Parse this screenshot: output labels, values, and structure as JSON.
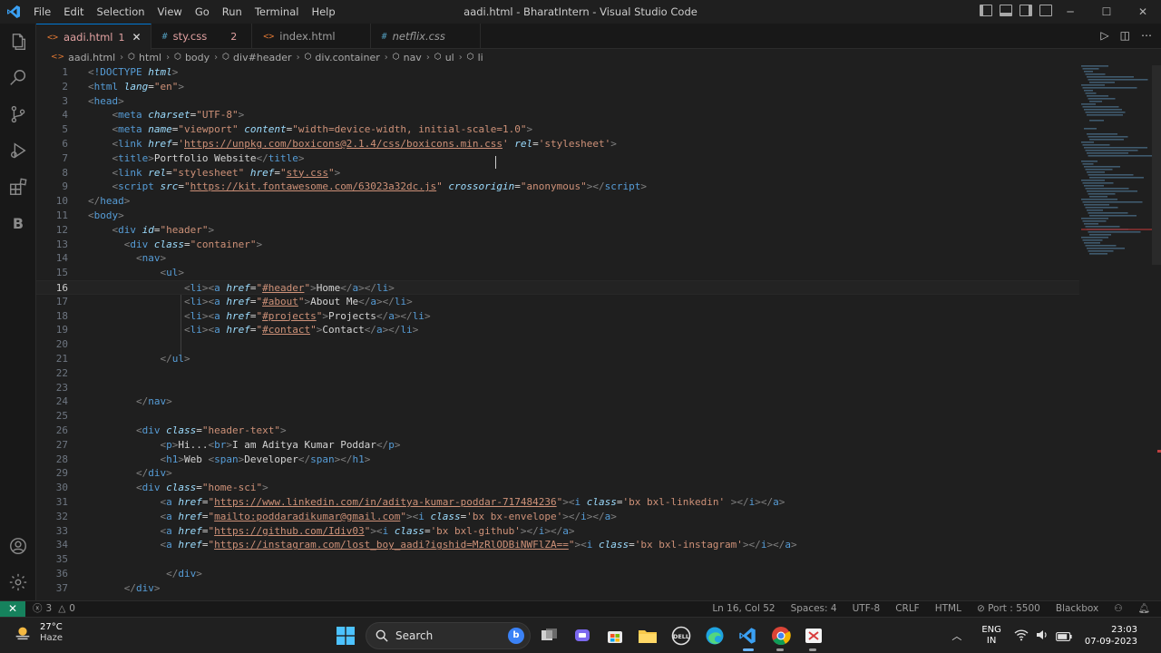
{
  "window": {
    "title": "aadi.html - BharatIntern - Visual Studio Code",
    "menu": [
      "File",
      "Edit",
      "Selection",
      "View",
      "Go",
      "Run",
      "Terminal",
      "Help"
    ]
  },
  "tabs": [
    {
      "label": "aadi.html",
      "icon": "<>",
      "badge": "1",
      "active": true,
      "color": "#e0a0a0"
    },
    {
      "label": "sty.css",
      "icon": "#",
      "badge": "2",
      "active": false,
      "color": "#e0a0a0"
    },
    {
      "label": "index.html",
      "icon": "<>",
      "badge": "",
      "active": false,
      "color": "#9d9d9d"
    },
    {
      "label": "netflix.css",
      "icon": "#",
      "badge": "",
      "active": false,
      "color": "#9d9d9d"
    }
  ],
  "breadcrumb": [
    "aadi.html",
    "html",
    "body",
    "div#header",
    "div.container",
    "nav",
    "ul",
    "li"
  ],
  "editor": {
    "current_line": 16,
    "lines": [
      {
        "n": "1",
        "html": "<span class='t-p'>&lt;</span><span class='t-tag'>!DOCTYPE</span> <span class='t-attr-i'>html</span><span class='t-p'>&gt;</span>"
      },
      {
        "n": "2",
        "html": "<span class='t-p'>&lt;</span><span class='t-tag'>html</span> <span class='t-attr-i'>lang</span><span class='t-text'>=</span><span class='t-str'>\"en\"</span><span class='t-p'>&gt;</span>"
      },
      {
        "n": "3",
        "html": "<span class='t-p'>&lt;</span><span class='t-tag'>head</span><span class='t-p'>&gt;</span>"
      },
      {
        "n": "4",
        "html": "    <span class='t-p'>&lt;</span><span class='t-tag'>meta</span> <span class='t-attr-i'>charset</span><span class='t-text'>=</span><span class='t-str'>\"UTF-8\"</span><span class='t-p'>&gt;</span>"
      },
      {
        "n": "5",
        "html": "    <span class='t-p'>&lt;</span><span class='t-tag'>meta</span> <span class='t-attr-i'>name</span><span class='t-text'>=</span><span class='t-str'>\"viewport\"</span> <span class='t-attr-i'>content</span><span class='t-text'>=</span><span class='t-str'>\"width=device-width, initial-scale=1.0\"</span><span class='t-p'>&gt;</span>"
      },
      {
        "n": "6",
        "html": "    <span class='t-p'>&lt;</span><span class='t-tag'>link</span> <span class='t-attr-i'>href</span><span class='t-text'>=</span><span class='t-str'>'</span><span class='t-link'>https://unpkg.com/boxicons@2.1.4/css/boxicons.min.css</span><span class='t-str'>'</span> <span class='t-attr-i'>rel</span><span class='t-text'>=</span><span class='t-str'>'stylesheet'</span><span class='t-p'>&gt;</span>"
      },
      {
        "n": "7",
        "html": "    <span class='t-p'>&lt;</span><span class='t-tag'>title</span><span class='t-p'>&gt;</span><span class='t-text'>Portfolio Website</span><span class='t-p'>&lt;/</span><span class='t-tag'>title</span><span class='t-p'>&gt;</span>"
      },
      {
        "n": "8",
        "html": "    <span class='t-p'>&lt;</span><span class='t-tag'>link</span> <span class='t-attr-i'>rel</span><span class='t-text'>=</span><span class='t-str'>\"stylesheet\"</span> <span class='t-attr-i'>href</span><span class='t-text'>=</span><span class='t-str'>\"</span><span class='t-link'>sty.css</span><span class='t-str'>\"</span><span class='t-p'>&gt;</span>"
      },
      {
        "n": "9",
        "html": "    <span class='t-p'>&lt;</span><span class='t-tag'>script</span> <span class='t-attr-i'>src</span><span class='t-text'>=</span><span class='t-str'>\"</span><span class='t-link'>https://kit.fontawesome.com/63023a32dc.js</span><span class='t-str'>\"</span> <span class='t-attr-i'>crossorigin</span><span class='t-text'>=</span><span class='t-str'>\"anonymous\"</span><span class='t-p'>&gt;&lt;/</span><span class='t-tag'>script</span><span class='t-p'>&gt;</span>"
      },
      {
        "n": "10",
        "html": "<span class='t-p'>&lt;/</span><span class='t-tag'>head</span><span class='t-p'>&gt;</span>"
      },
      {
        "n": "11",
        "html": "<span class='t-p'>&lt;</span><span class='t-tag'>body</span><span class='t-p'>&gt;</span>"
      },
      {
        "n": "12",
        "html": "    <span class='t-p'>&lt;</span><span class='t-tag'>div</span> <span class='t-attr-i'>id</span><span class='t-text'>=</span><span class='t-str'>\"header\"</span><span class='t-p'>&gt;</span>"
      },
      {
        "n": "13",
        "html": "      <span class='t-p'>&lt;</span><span class='t-tag'>div</span> <span class='t-attr-i'>class</span><span class='t-text'>=</span><span class='t-str'>\"container\"</span><span class='t-p'>&gt;</span>"
      },
      {
        "n": "14",
        "html": "        <span class='t-p'>&lt;</span><span class='t-tag'>nav</span><span class='t-p'>&gt;</span>"
      },
      {
        "n": "15",
        "html": "            <span class='t-p'>&lt;</span><span class='t-tag'>ul</span><span class='t-p'>&gt;</span>"
      },
      {
        "n": "16",
        "html": "                <span class='t-p'>&lt;</span><span class='t-tag'>li</span><span class='t-p'>&gt;&lt;</span><span class='t-tag'>a</span> <span class='t-attr-i'>href</span><span class='t-text'>=</span><span class='t-str'>\"</span><span class='t-link'>#header</span><span class='t-str'>\"</span><span class='t-p'>&gt;</span><span class='t-text'>Home</span><span class='t-p'>&lt;/</span><span class='t-tag'>a</span><span class='t-p'>&gt;&lt;/</span><span class='t-tag'>li</span><span class='t-p'>&gt;</span>"
      },
      {
        "n": "17",
        "html": "                <span class='t-p'>&lt;</span><span class='t-tag'>li</span><span class='t-p'>&gt;&lt;</span><span class='t-tag'>a</span> <span class='t-attr-i'>href</span><span class='t-text'>=</span><span class='t-str'>\"</span><span class='t-link'>#about</span><span class='t-str'>\"</span><span class='t-p'>&gt;</span><span class='t-text'>About Me</span><span class='t-p'>&lt;/</span><span class='t-tag'>a</span><span class='t-p'>&gt;&lt;/</span><span class='t-tag'>li</span><span class='t-p'>&gt;</span>"
      },
      {
        "n": "18",
        "html": "                <span class='t-p'>&lt;</span><span class='t-tag'>li</span><span class='t-p'>&gt;&lt;</span><span class='t-tag'>a</span> <span class='t-attr-i'>href</span><span class='t-text'>=</span><span class='t-str'>\"</span><span class='t-link'>#projects</span><span class='t-str'>\"</span><span class='t-p'>&gt;</span><span class='t-text'>Projects</span><span class='t-p'>&lt;/</span><span class='t-tag'>a</span><span class='t-p'>&gt;&lt;/</span><span class='t-tag'>li</span><span class='t-p'>&gt;</span>"
      },
      {
        "n": "19",
        "html": "                <span class='t-p'>&lt;</span><span class='t-tag'>li</span><span class='t-p'>&gt;&lt;</span><span class='t-tag'>a</span> <span class='t-attr-i'>href</span><span class='t-text'>=</span><span class='t-str'>\"</span><span class='t-link'>#contact</span><span class='t-str'>\"</span><span class='t-p'>&gt;</span><span class='t-text'>Contact</span><span class='t-p'>&lt;/</span><span class='t-tag'>a</span><span class='t-p'>&gt;&lt;/</span><span class='t-tag'>li</span><span class='t-p'>&gt;</span>"
      },
      {
        "n": "20",
        "html": ""
      },
      {
        "n": "21",
        "html": "            <span class='t-p'>&lt;/</span><span class='t-tag'>ul</span><span class='t-p'>&gt;</span>"
      },
      {
        "n": "22",
        "html": ""
      },
      {
        "n": "23",
        "html": ""
      },
      {
        "n": "24",
        "html": "        <span class='t-p'>&lt;/</span><span class='t-tag'>nav</span><span class='t-p'>&gt;</span>"
      },
      {
        "n": "25",
        "html": ""
      },
      {
        "n": "26",
        "html": "        <span class='t-p'>&lt;</span><span class='t-tag'>div</span> <span class='t-attr-i'>class</span><span class='t-text'>=</span><span class='t-str'>\"header-text\"</span><span class='t-p'>&gt;</span>"
      },
      {
        "n": "27",
        "html": "            <span class='t-p'>&lt;</span><span class='t-tag'>p</span><span class='t-p'>&gt;</span><span class='t-text'>Hi...</span><span class='t-p'>&lt;</span><span class='t-tag'>br</span><span class='t-p'>&gt;</span><span class='t-text'>I am Aditya Kumar Poddar</span><span class='t-p'>&lt;/</span><span class='t-tag'>p</span><span class='t-p'>&gt;</span>"
      },
      {
        "n": "28",
        "html": "            <span class='t-p'>&lt;</span><span class='t-tag'>h1</span><span class='t-p'>&gt;</span><span class='t-text'>Web </span><span class='t-p'>&lt;</span><span class='t-tag'>span</span><span class='t-p'>&gt;</span><span class='t-text'>Developer</span><span class='t-p'>&lt;/</span><span class='t-tag'>span</span><span class='t-p'>&gt;&lt;/</span><span class='t-tag'>h1</span><span class='t-p'>&gt;</span>"
      },
      {
        "n": "29",
        "html": "        <span class='t-p'>&lt;/</span><span class='t-tag'>div</span><span class='t-p'>&gt;</span>"
      },
      {
        "n": "30",
        "html": "        <span class='t-p'>&lt;</span><span class='t-tag'>div</span> <span class='t-attr-i'>class</span><span class='t-text'>=</span><span class='t-str'>\"home-sci\"</span><span class='t-p'>&gt;</span>"
      },
      {
        "n": "31",
        "html": "            <span class='t-p'>&lt;</span><span class='t-tag'>a</span> <span class='t-attr-i'>href</span><span class='t-text'>=</span><span class='t-str'>\"</span><span class='t-link'>https://www.linkedin.com/in/aditya-kumar-poddar-717484236</span><span class='t-str'>\"</span><span class='t-p'>&gt;&lt;</span><span class='t-tag'>i</span> <span class='t-attr-i'>class</span><span class='t-text'>=</span><span class='t-str'>'bx bxl-linkedin'</span> <span class='t-p'>&gt;&lt;/</span><span class='t-tag'>i</span><span class='t-p'>&gt;&lt;/</span><span class='t-tag'>a</span><span class='t-p'>&gt;</span>"
      },
      {
        "n": "32",
        "html": "            <span class='t-p'>&lt;</span><span class='t-tag'>a</span> <span class='t-attr-i'>href</span><span class='t-text'>=</span><span class='t-str'>\"</span><span class='t-link'>mailto:poddaradikumar@gmail.com</span><span class='t-str'>\"</span><span class='t-p'>&gt;&lt;</span><span class='t-tag'>i</span> <span class='t-attr-i'>class</span><span class='t-text'>=</span><span class='t-str'>'bx bx-envelope'</span><span class='t-p'>&gt;&lt;/</span><span class='t-tag'>i</span><span class='t-p'>&gt;&lt;/</span><span class='t-tag'>a</span><span class='t-p'>&gt;</span>"
      },
      {
        "n": "33",
        "html": "            <span class='t-p'>&lt;</span><span class='t-tag'>a</span> <span class='t-attr-i'>href</span><span class='t-text'>=</span><span class='t-str'>\"</span><span class='t-link'>https://github.com/Idiv03</span><span class='t-str'>\"</span><span class='t-p'>&gt;&lt;</span><span class='t-tag'>i</span> <span class='t-attr-i'>class</span><span class='t-text'>=</span><span class='t-str'>'bx bxl-github'</span><span class='t-p'>&gt;&lt;/</span><span class='t-tag'>i</span><span class='t-p'>&gt;&lt;/</span><span class='t-tag'>a</span><span class='t-p'>&gt;</span>"
      },
      {
        "n": "34",
        "html": "            <span class='t-p'>&lt;</span><span class='t-tag'>a</span> <span class='t-attr-i'>href</span><span class='t-text'>=</span><span class='t-str'>\"</span><span class='t-link'>https://instagram.com/lost_boy_aadi?igshid=MzRlODBiNWFlZA==</span><span class='t-str'>\"</span><span class='t-p'>&gt;&lt;</span><span class='t-tag'>i</span> <span class='t-attr-i'>class</span><span class='t-text'>=</span><span class='t-str'>'bx bxl-instagram'</span><span class='t-p'>&gt;&lt;/</span><span class='t-tag'>i</span><span class='t-p'>&gt;&lt;/</span><span class='t-tag'>a</span><span class='t-p'>&gt;</span>"
      },
      {
        "n": "35",
        "html": ""
      },
      {
        "n": "36",
        "html": "             <span class='t-p'>&lt;/</span><span class='t-tag'>div</span><span class='t-p'>&gt;</span>"
      },
      {
        "n": "37",
        "html": "      <span class='t-p'>&lt;/</span><span class='t-tag'>div</span><span class='t-p'>&gt;</span>"
      }
    ]
  },
  "status": {
    "errors": "3",
    "warnings": "0",
    "position": "Ln 16, Col 52",
    "spaces": "Spaces: 4",
    "encoding": "UTF-8",
    "eol": "CRLF",
    "language": "HTML",
    "port": "Port : 5500",
    "extension": "Blackbox"
  },
  "taskbar": {
    "temperature": "27°C",
    "condition": "Haze",
    "search_label": "Search",
    "lang_top": "ENG",
    "lang_bottom": "IN",
    "time": "23:03",
    "date": "07-09-2023"
  },
  "colors": {
    "accent": "#0078d4",
    "remote": "#16825d",
    "error_tab": "#e0a0a0"
  }
}
